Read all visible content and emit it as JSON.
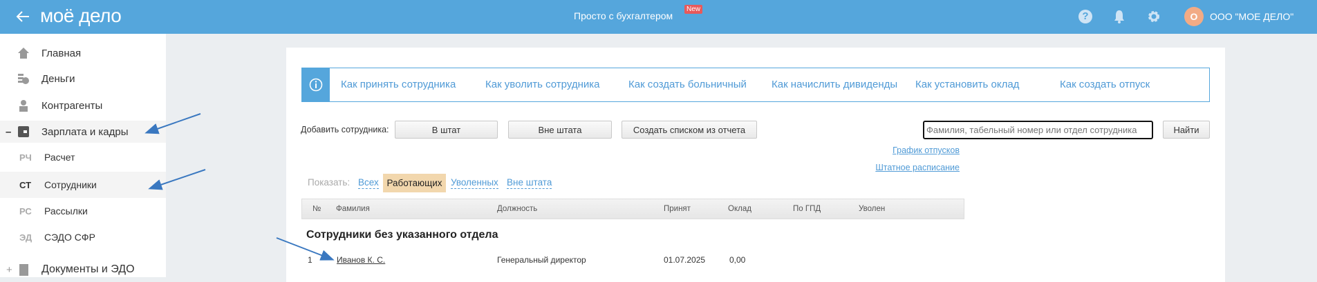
{
  "header": {
    "back_icon": "arrow-left-icon",
    "logo": "моё дело",
    "center_title": "Просто с бухгалтером",
    "new_badge": "New",
    "icons": [
      "help-icon",
      "bell-icon",
      "gear-icon"
    ],
    "avatar_letter": "О",
    "org_name": "ООО \"МОЕ ДЕЛО\"",
    "colors": {
      "bar": "#55a6dc",
      "badge": "#e8595a",
      "avatar": "#f2ab85"
    }
  },
  "sidebar": {
    "items": [
      {
        "label": "Главная",
        "icon": "home-icon"
      },
      {
        "label": "Деньги",
        "icon": "money-icon"
      },
      {
        "label": "Контрагенты",
        "icon": "contractor-icon"
      },
      {
        "label": "Зарплата и кадры",
        "icon": "wallet-icon",
        "toggle": "–"
      }
    ],
    "sub": [
      {
        "abbr": "РЧ",
        "label": "Расчет"
      },
      {
        "abbr": "СТ",
        "label": "Сотрудники"
      },
      {
        "abbr": "РС",
        "label": "Рассылки"
      },
      {
        "abbr": "ЭД",
        "label": "СЭДО СФР"
      }
    ],
    "docs": {
      "label": "Документы и ЭДО",
      "toggle": "+",
      "icon": "folder-icon"
    }
  },
  "info": {
    "links": [
      "Как принять сотрудника",
      "Как уволить сотрудника",
      "Как создать больничный",
      "Как начислить дивиденды",
      "Как установить оклад",
      "Как создать отпуск"
    ]
  },
  "add": {
    "label": "Добавить сотрудника:",
    "buttons": [
      "В штат",
      "Вне штата",
      "Создать списком из отчета"
    ]
  },
  "search": {
    "placeholder": "Фамилия, табельный номер или отдел сотрудника",
    "button": "Найти"
  },
  "links": {
    "vacations": "График отпусков",
    "staffing": "Штатное расписание"
  },
  "filter": {
    "label": "Показать:",
    "options": [
      "Всех",
      "Работающих",
      "Уволенных",
      "Вне штата"
    ],
    "active": "Работающих"
  },
  "table": {
    "columns": [
      "№",
      "Фамилия",
      "Должность",
      "Принят",
      "Оклад",
      "По ГПД",
      "Уволен"
    ],
    "group": "Сотрудники без указанного отдела",
    "rows": [
      {
        "num": "1",
        "name": "Иванов К. С.",
        "position": "Генеральный директор",
        "hired": "01.07.2025",
        "salary": "0,00"
      }
    ]
  }
}
